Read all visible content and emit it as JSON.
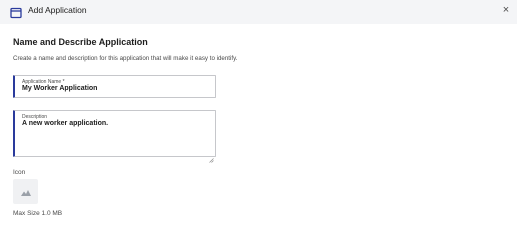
{
  "dialog": {
    "title": "Add Application",
    "close_label": "×"
  },
  "section": {
    "title": "Name and Describe Application",
    "description": "Create a name and description for this application that will make it easy to identify."
  },
  "name_field": {
    "label": "Application Name *",
    "value": "My Worker Application"
  },
  "description_field": {
    "label": "Description",
    "value": "A new worker application."
  },
  "icon_upload": {
    "label": "Icon",
    "icon": "image-placeholder-icon",
    "max_size": "Max Size 1.0 MB"
  },
  "colors": {
    "accent": "#2a3a9c",
    "header_bg": "#f4f5f7"
  }
}
